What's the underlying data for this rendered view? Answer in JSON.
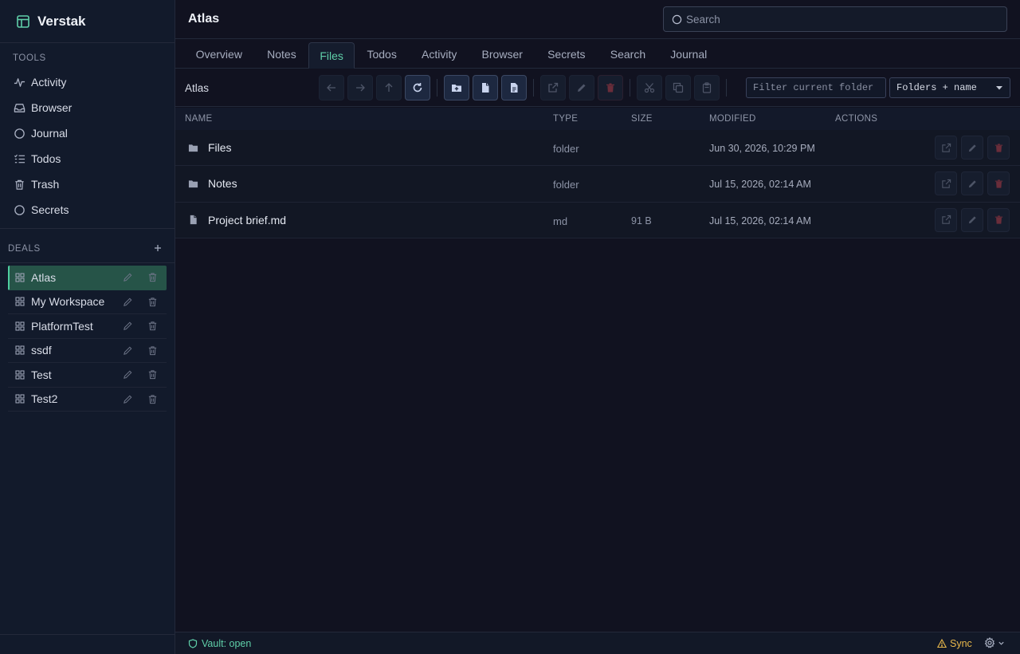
{
  "app": {
    "name": "Verstak"
  },
  "sidebar": {
    "tools_label": "TOOLS",
    "tools": [
      {
        "label": "Activity",
        "icon": "activity-icon"
      },
      {
        "label": "Browser",
        "icon": "inbox-icon"
      },
      {
        "label": "Journal",
        "icon": "circle-icon"
      },
      {
        "label": "Todos",
        "icon": "checklist-icon"
      },
      {
        "label": "Trash",
        "icon": "trash-icon"
      },
      {
        "label": "Secrets",
        "icon": "circle-icon"
      }
    ],
    "deals_label": "DEALS",
    "deals_add": "+",
    "deals": [
      {
        "label": "Atlas",
        "active": true
      },
      {
        "label": "My Workspace",
        "active": false
      },
      {
        "label": "PlatformTest",
        "active": false
      },
      {
        "label": "ssdf",
        "active": false
      },
      {
        "label": "Test",
        "active": false
      },
      {
        "label": "Test2",
        "active": false
      }
    ]
  },
  "header": {
    "title": "Atlas",
    "search_placeholder": "Search"
  },
  "tabs": [
    {
      "label": "Overview",
      "active": false
    },
    {
      "label": "Notes",
      "active": false
    },
    {
      "label": "Files",
      "active": true
    },
    {
      "label": "Todos",
      "active": false
    },
    {
      "label": "Activity",
      "active": false
    },
    {
      "label": "Browser",
      "active": false
    },
    {
      "label": "Secrets",
      "active": false
    },
    {
      "label": "Search",
      "active": false
    },
    {
      "label": "Journal",
      "active": false
    }
  ],
  "toolbar": {
    "breadcrumb": "Atlas",
    "filter_placeholder": "Filter current folder",
    "sort_value": "Folders + name"
  },
  "table": {
    "columns": [
      "NAME",
      "TYPE",
      "SIZE",
      "MODIFIED",
      "ACTIONS"
    ],
    "rows": [
      {
        "name": "Files",
        "type": "folder",
        "size": "",
        "modified": "Jun 30, 2026, 10:29 PM",
        "icon": "folder-icon"
      },
      {
        "name": "Notes",
        "type": "folder",
        "size": "",
        "modified": "Jul 15, 2026, 02:14 AM",
        "icon": "folder-icon"
      },
      {
        "name": "Project brief.md",
        "type": "md",
        "size": "91 B",
        "modified": "Jul 15, 2026, 02:14 AM",
        "icon": "file-icon"
      }
    ]
  },
  "status": {
    "vault": "Vault: open",
    "sync": "Sync"
  },
  "colors": {
    "accent": "#5fcfa9",
    "warning": "#e9b84b",
    "danger": "#6a2d3a",
    "active_deal_bg": "#265448"
  }
}
